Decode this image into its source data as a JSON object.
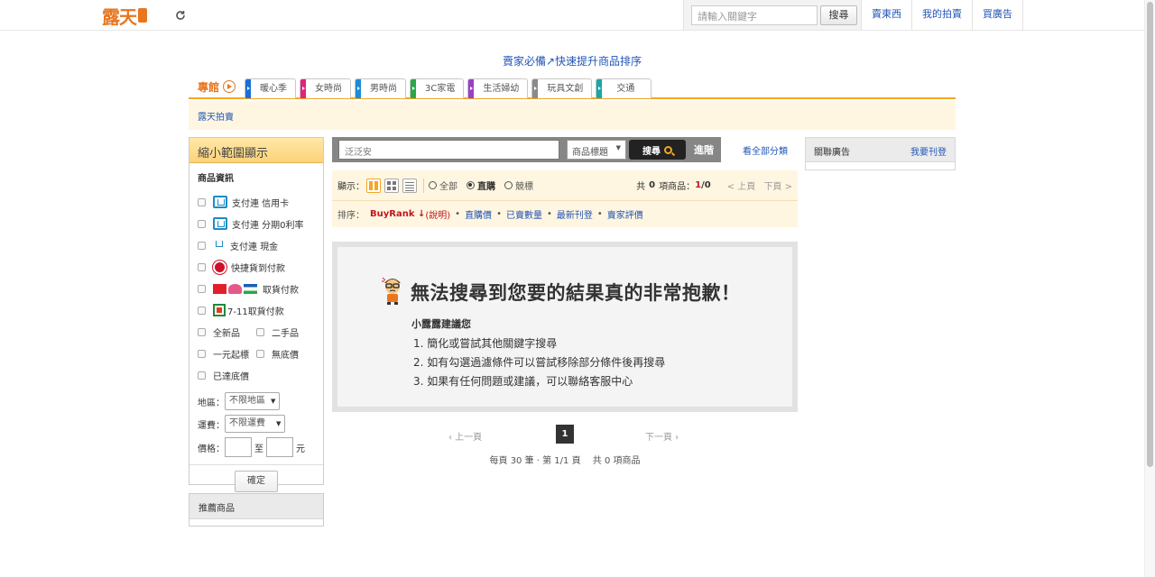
{
  "header": {
    "logo_text": "露天",
    "search_placeholder": "請輸入關鍵字",
    "search_button": "搜尋",
    "links": [
      "賣東西",
      "我的拍賣",
      "買廣告"
    ]
  },
  "promo": {
    "text": "賣家必備↗快速提升商品排序"
  },
  "category": {
    "label": "專館",
    "tabs": [
      {
        "label": "暖心季",
        "color": "#1a6fd6"
      },
      {
        "label": "女時尚",
        "color": "#e0247a"
      },
      {
        "label": "男時尚",
        "color": "#1a8cd8"
      },
      {
        "label": "3C家電",
        "color": "#2aa845"
      },
      {
        "label": "生活婦幼",
        "color": "#9b3fc8"
      },
      {
        "label": "玩具文創",
        "color": "#8a8a8a"
      },
      {
        "label": "交通",
        "color": "#18a6a6"
      }
    ]
  },
  "breadcrumb": {
    "text": "露天拍賣"
  },
  "filter": {
    "title": "縮小範圍顯示",
    "section_title": "商品資訊",
    "payments": [
      {
        "label": "支付連 信用卡",
        "icon": "pay-card-icon"
      },
      {
        "label": "支付連 分期0利率",
        "icon": "pay-installment-icon"
      },
      {
        "label": "支付連 現金",
        "icon": "pay-cash-icon"
      },
      {
        "label": "快捷貨到付款",
        "icon": "cod-icon"
      },
      {
        "label": "取貨付款",
        "icon": "convenience-store-icons"
      },
      {
        "label": "7-11取貨付款",
        "icon": "seven-eleven-icon"
      }
    ],
    "new_item": "全新品",
    "used_item": "二手品",
    "one_dollar": "一元起標",
    "no_reserve": "無底價",
    "reserve_met": "已達底價",
    "region_label": "地區：",
    "region_value": "不限地區",
    "shipping_label": "運費：",
    "shipping_value": "不限運費",
    "price_label": "價格：",
    "price_to": "至",
    "price_unit": "元",
    "confirm": "確定"
  },
  "recommend": {
    "title": "推薦商品"
  },
  "search": {
    "query": "泛泛安",
    "scope": "商品標題",
    "button": "搜尋",
    "advanced": "進階",
    "all_categories": "看全部分類"
  },
  "view": {
    "label": "顯示：",
    "filters": [
      "全部",
      "直購",
      "競標"
    ],
    "selected_filter": "直購",
    "count_prefix": "共",
    "count": "0",
    "count_suffix": "項商品：",
    "page_current": "1",
    "page_total": "/0",
    "prev": "< 上頁",
    "next": "下頁 >"
  },
  "sort": {
    "label": "排序：",
    "active": "BuyRank ↓",
    "note": "(說明)",
    "items": [
      "直購價",
      "已賣數量",
      "最新刊登",
      "賣家評價"
    ]
  },
  "empty": {
    "title": "無法搜尋到您要的結果真的非常抱歉！",
    "tip_title": "小露露建議您",
    "tips": [
      "1. 簡化或嘗試其他關鍵字搜尋",
      "2. 如有勾選過濾條件可以嘗試移除部分條件後再搜尋",
      "3. 如果有任何問題或建議，可以聯絡客服中心"
    ]
  },
  "pager": {
    "prev": "‹ 上一頁",
    "current": "1",
    "next": "下一頁 ›",
    "info": "每頁 30 筆 · 第 1/1 頁　 共 0 項商品"
  },
  "ads": {
    "title": "關聯廣告",
    "link": "我要刊登"
  }
}
